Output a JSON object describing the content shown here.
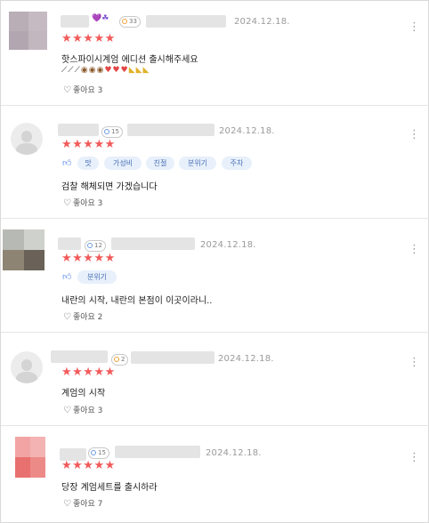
{
  "reviews": [
    {
      "date": "2024.12.18.",
      "level": "33",
      "stars": "★★★★★",
      "text": "핫스파이시계엄 에디션 출시해주세요",
      "likes": "좋아요 3",
      "badge_emojis": "💜☘"
    },
    {
      "date": "2024.12.18.",
      "level": "15",
      "stars": "★★★★★",
      "tags": [
        "맛",
        "가성비",
        "친절",
        "분위기",
        "주차"
      ],
      "text": "검찰 해체되면 가겠습니다",
      "likes": "좋아요 3"
    },
    {
      "date": "2024.12.18.",
      "level": "12",
      "stars": "★★★★★",
      "tags": [
        "분위기"
      ],
      "text": "내란의 시작, 내란의 본점이 이곳이라니..",
      "likes": "좋아요 2"
    },
    {
      "date": "2024.12.18.",
      "level": "2",
      "stars": "★★★★★",
      "text": "계엄의 시작",
      "likes": "좋아요 3"
    },
    {
      "date": "2024.12.18.",
      "level": "15",
      "stars": "★★★★★",
      "text": "당장 계엄세트를 출시하라",
      "likes": "좋아요 7"
    }
  ],
  "icons": {
    "more": "more-vertical-icon",
    "heart": "heart-outline-icon",
    "thumb": "thumbs-up-icon"
  },
  "colors": {
    "star": "#f25a5a",
    "tag_bg": "#e7f0fb",
    "tag_text": "#4a6fb5",
    "date": "#9a9a9a"
  }
}
